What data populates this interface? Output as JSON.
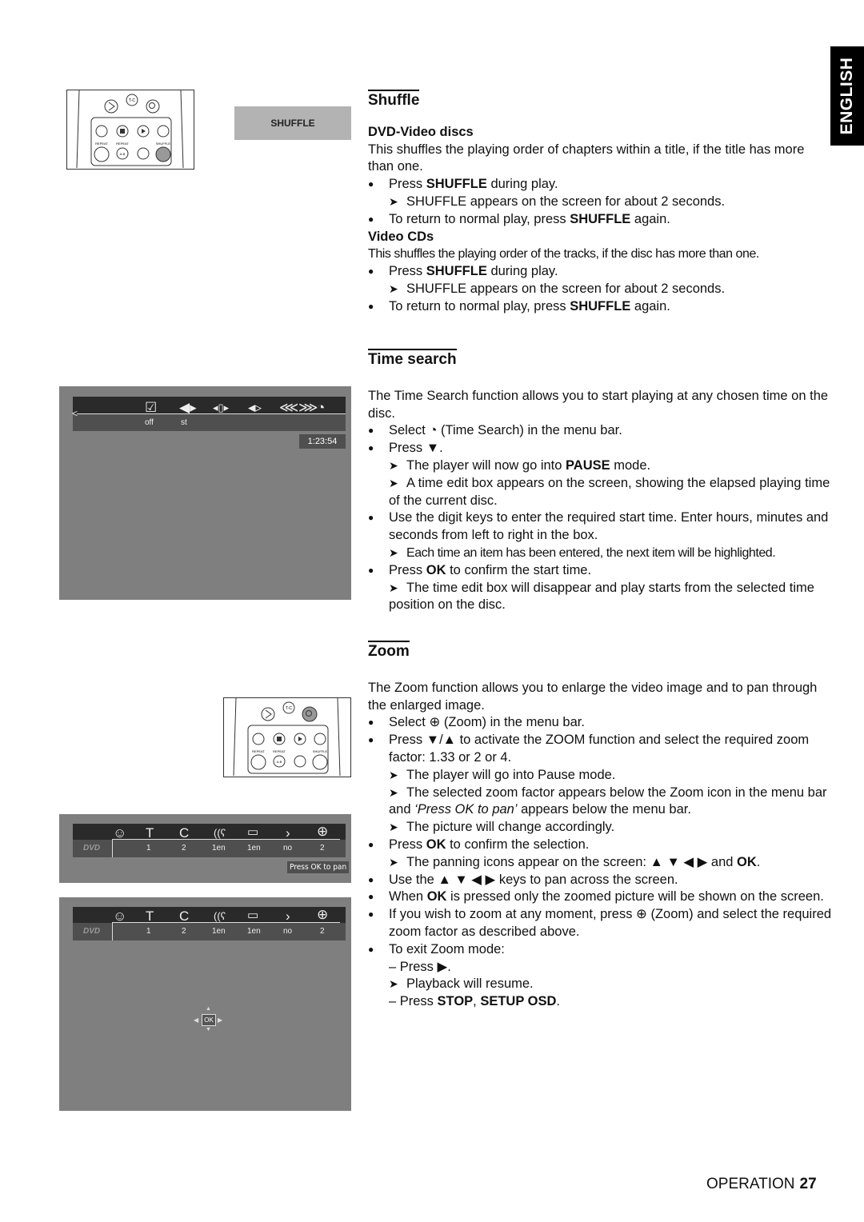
{
  "language_tab": "ENGLISH",
  "footer": {
    "section": "OPERATION",
    "page": "27"
  },
  "remote": {
    "labels": {
      "tc": "T-C",
      "repeat": "REPEAT",
      "repeat_ab": "REPEAT",
      "ab": "A-B",
      "shuffle": "SHUFFLE"
    }
  },
  "osd_shuffle": "SHUFFLE",
  "time_search_screen": {
    "icons": [
      "check-icon",
      "audio-icon",
      "frame-icon",
      "angle-icon",
      "shuffle-arrows-icon",
      "time-search-icon"
    ],
    "values": [
      "off",
      "st"
    ],
    "time_box": "1:23:54"
  },
  "zoom_screen": {
    "icons": [
      "user-icon",
      "title-icon",
      "chapter-icon",
      "audio-language-icon",
      "subtitle-icon",
      "angle-icon",
      "zoom-icon"
    ],
    "dvd_logo": "DVD",
    "values": [
      "1",
      "2",
      "1en",
      "1en",
      "no",
      "2"
    ],
    "pan_label": "Press OK to pan",
    "ok_label": "OK"
  },
  "shuffle": {
    "title": "Shuffle",
    "dvd": {
      "heading": "DVD-Video discs",
      "intro": "This shuffles the playing order of chapters within a title, if the title has more than one.",
      "b1_pre": "Press ",
      "b1_bold": "SHUFFLE",
      "b1_post": " during play.",
      "a1": "SHUFFLE appears on the screen for about 2 seconds.",
      "b2_pre": "To return to normal play, press ",
      "b2_bold": "SHUFFLE",
      "b2_post": " again."
    },
    "vcd": {
      "heading": "Video CDs",
      "intro": "This shuffles the playing order of the tracks, if the disc has more than one.",
      "b1_pre": "Press ",
      "b1_bold": "SHUFFLE",
      "b1_post": " during play.",
      "a1": "SHUFFLE appears on the screen for about 2 seconds.",
      "b2_pre": "To return to normal play, press ",
      "b2_bold": "SHUFFLE",
      "b2_post": " again."
    }
  },
  "time_search": {
    "title": "Time search",
    "intro": "The Time Search function allows you to start playing at any chosen time on the disc.",
    "b1_pre": "Select ",
    "b1_post": " (Time Search) in the menu bar.",
    "b2": "Press ▼.",
    "a1_pre": "The player will now go into ",
    "a1_bold": "PAUSE",
    "a1_post": " mode.",
    "a2": "A time edit box appears on the screen, showing the elapsed playing time of the current disc.",
    "b3": "Use the digit keys to enter the required start time. Enter hours, minutes and seconds from left to right in the box.",
    "a3": "Each time an item has been entered, the next item will be highlighted.",
    "b4_pre": "Press ",
    "b4_bold": "OK",
    "b4_post": " to confirm the start time.",
    "a4": "The time edit box will disappear and play starts from the selected time position on the disc."
  },
  "zoom": {
    "title": "Zoom",
    "intro": "The Zoom function allows you to enlarge the video image and to pan through the enlarged image.",
    "b1_pre": "Select ",
    "b1_post": " (Zoom) in the menu bar.",
    "b2": "Press ▼/▲ to activate the ZOOM function and select the required zoom factor: 1.33 or 2 or 4.",
    "a1": "The player will go into Pause mode.",
    "a2_pre": "The selected zoom factor appears below the Zoom icon in the menu bar and ",
    "a2_italic": "‘Press OK to pan’",
    "a2_post": " appears below the menu bar.",
    "a3": "The picture will change accordingly.",
    "b3_pre": "Press ",
    "b3_bold": "OK",
    "b3_post": " to confirm the selection.",
    "a4_pre": "The panning icons appear on the screen: ▲ ▼ ◀ ▶ and ",
    "a4_bold": "OK",
    "a4_post": ".",
    "b4": "Use the ▲ ▼ ◀ ▶ keys to pan across the screen.",
    "b5_pre": "When ",
    "b5_bold": "OK",
    "b5_post": " is pressed only the zoomed picture will be shown on the screen.",
    "b6_pre": "If you wish to zoom at any moment, press ",
    "b6_post": " (Zoom) and select the required zoom factor as described above.",
    "b7": "To exit Zoom mode:",
    "d1": "– Press ▶.",
    "a5": "Playback will resume.",
    "d2_pre": "– Press ",
    "d2_bold": "STOP",
    "d2_mid": ", ",
    "d2_bold2": "SETUP OSD",
    "d2_post": "."
  }
}
